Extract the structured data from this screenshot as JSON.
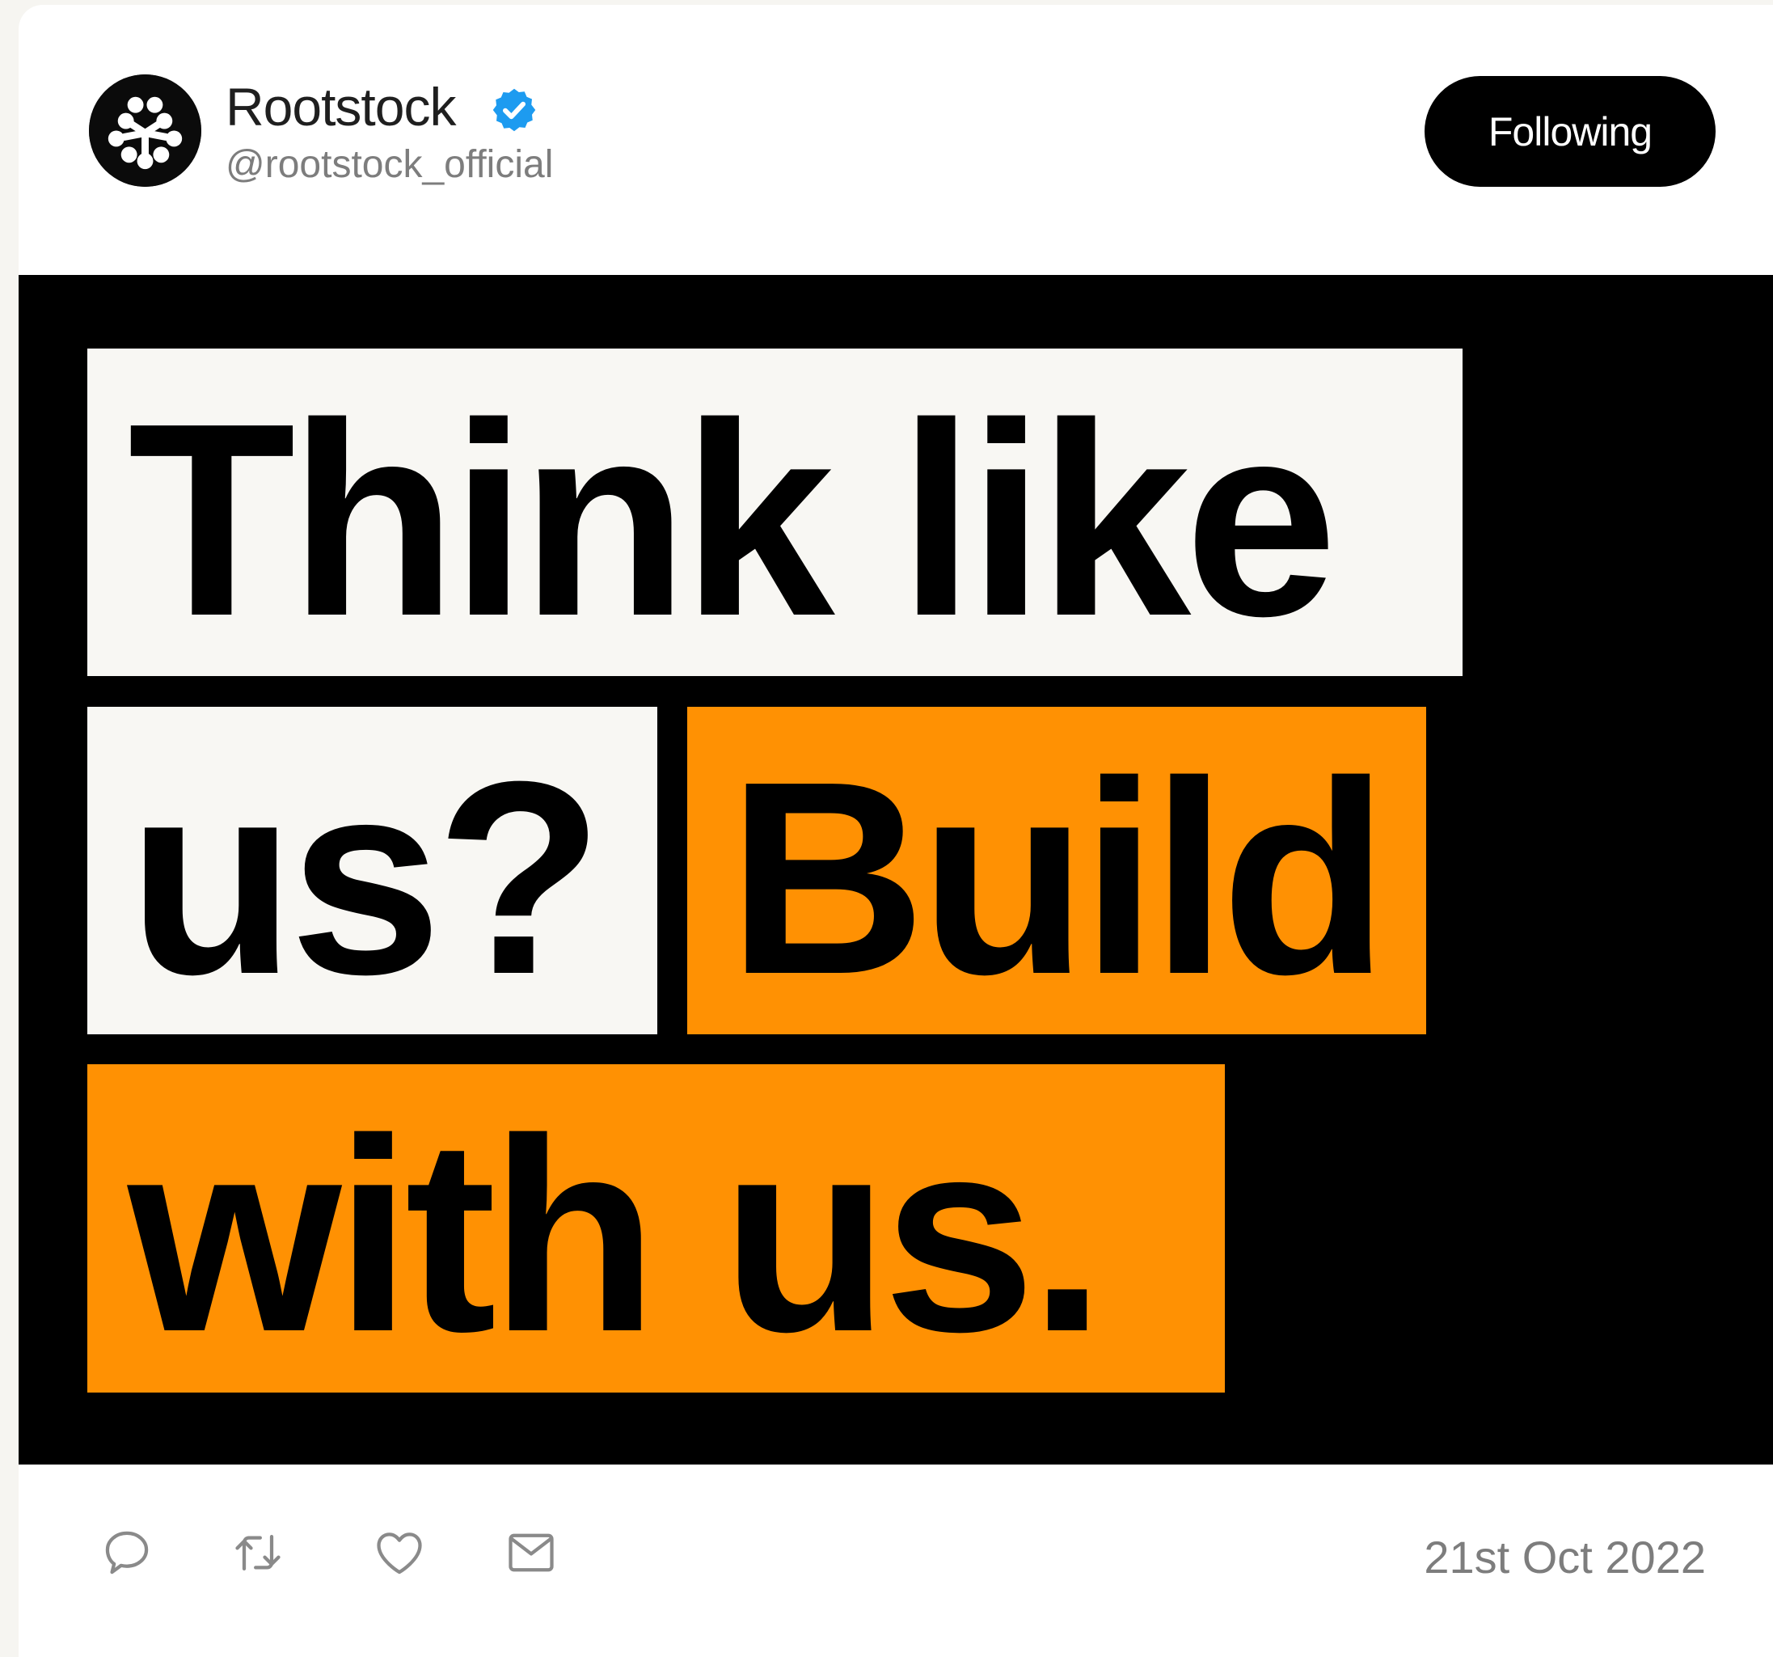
{
  "post": {
    "author": {
      "display_name": "Rootstock",
      "handle": "@rootstock_official",
      "verified": true,
      "avatar_icon": "rootstock-logo-icon"
    },
    "follow_button_label": "Following",
    "image_text": {
      "block1": "Think like",
      "block2": "us?",
      "block3": "Build",
      "block4": "with us."
    },
    "actions": [
      "reply-icon",
      "retweet-icon",
      "like-icon",
      "mail-icon"
    ],
    "date": "21st Oct 2022"
  },
  "colors": {
    "accent_orange": "#ff9103",
    "media_background": "#000000",
    "light_block": "#f8f7f3",
    "verified_blue": "#1d9bf0",
    "secondary_text": "#7d7d7d"
  }
}
